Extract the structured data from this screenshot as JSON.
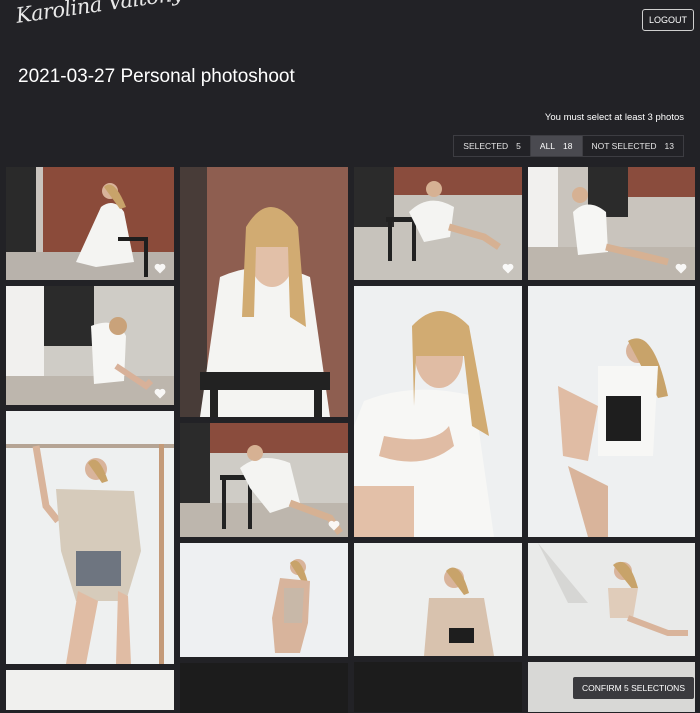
{
  "header": {
    "logo_text": "Karolina Vaitonyte",
    "logout_label": "LOGOUT"
  },
  "page": {
    "title": "2021-03-27 Personal photoshoot",
    "notice": "You must select at least 3 photos"
  },
  "filters": [
    {
      "label": "SELECTED",
      "count": "5",
      "active": false
    },
    {
      "label": "ALL",
      "count": "18",
      "active": true
    },
    {
      "label": "NOT SELECTED",
      "count": "13",
      "active": false
    }
  ],
  "photos": [
    {
      "desc": "brick wall window chair white shirt",
      "favorite": true
    },
    {
      "desc": "close-up hand on chin chair",
      "favorite": false
    },
    {
      "desc": "sitting on stool brick wall",
      "favorite": true
    },
    {
      "desc": "sitting on floor sunlight",
      "favorite": true
    },
    {
      "desc": "sitting on floor hugging knees",
      "favorite": true
    },
    {
      "desc": "white studio sitting",
      "favorite": false
    },
    {
      "desc": "white studio stool",
      "favorite": false
    },
    {
      "desc": "standing pole swimsuit",
      "favorite": false
    },
    {
      "desc": "floor by stool brick wall",
      "favorite": true
    },
    {
      "desc": "white room standing",
      "favorite": false
    },
    {
      "desc": "white room seated",
      "favorite": false
    },
    {
      "desc": "white room sitting sunlight",
      "favorite": false
    }
  ],
  "confirm_label": "CONFIRM 5 SELECTIONS",
  "colors": {
    "background": "#222226",
    "accent": "#4a4a50"
  }
}
